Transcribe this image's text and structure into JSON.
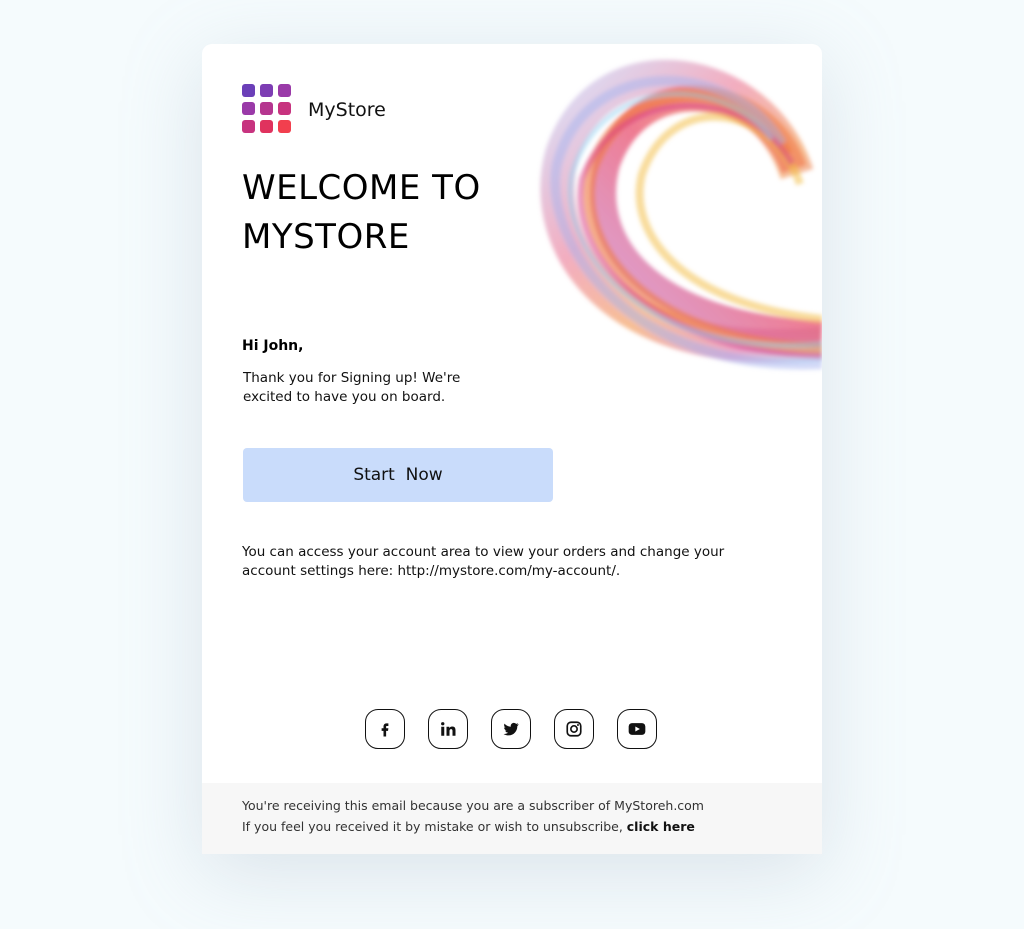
{
  "brand": {
    "name": "MyStore",
    "logo_icon": "grid-logo-icon",
    "logo_colors": [
      "#6b3fb8",
      "#9a3aa8",
      "#c7337f",
      "#e0325e",
      "#f23f4e"
    ]
  },
  "hero": {
    "headline": "WELCOME TO MYSTORE",
    "decoration_icon": "color-swirl-icon"
  },
  "message": {
    "greeting": "Hi John,",
    "intro": "Thank you for Signing up! We're excited to have you on board.",
    "cta_label": "Start  Now",
    "account_note": "You can access your account area to view your orders and change your account settings here: http://mystore.com/my-account/."
  },
  "socials": [
    {
      "icon": "facebook-icon"
    },
    {
      "icon": "linkedin-icon"
    },
    {
      "icon": "twitter-icon"
    },
    {
      "icon": "instagram-icon"
    },
    {
      "icon": "youtube-icon"
    }
  ],
  "footer": {
    "line1": "You're receiving this email because you are a subscriber of MyStoreh.com",
    "line2_prefix": "If you feel you received it by mistake or wish to unsubscribe, ",
    "unsubscribe_link": "click here"
  },
  "colors": {
    "cta_background": "#c9dcfb",
    "footer_background": "#f7f7f7",
    "page_background": "#f5fbfd"
  }
}
